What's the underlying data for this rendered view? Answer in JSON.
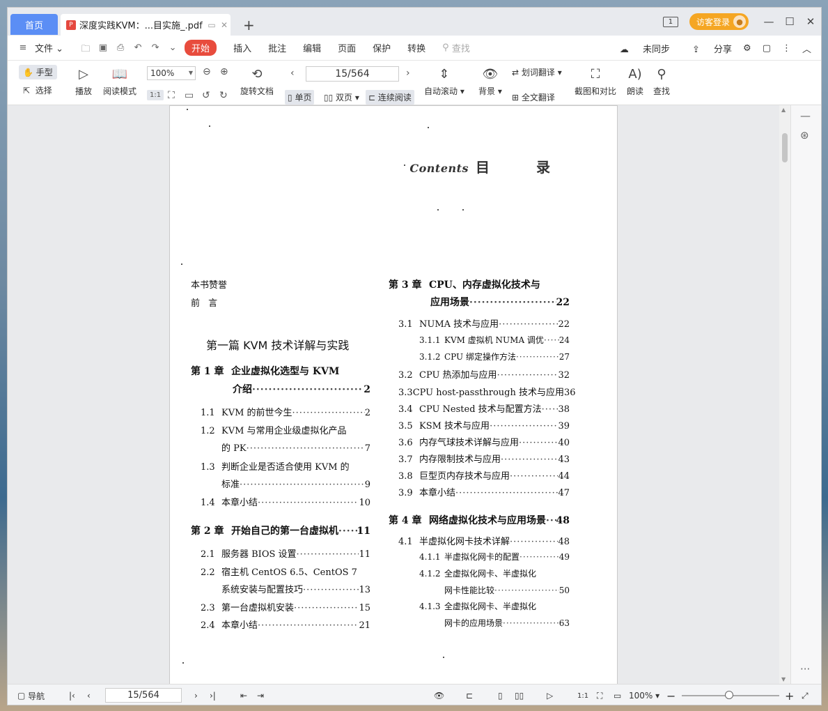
{
  "titlebar": {
    "home_tab": "首页",
    "doc_tab_title": "深度实践KVM：...目实施_.pdf",
    "new_tab": "+",
    "win_num": "1",
    "login": "访客登录"
  },
  "menu": {
    "file": "文件",
    "start": "开始",
    "items": [
      "插入",
      "批注",
      "编辑",
      "页面",
      "保护",
      "转换"
    ],
    "search": "查找",
    "sync": "未同步",
    "share": "分享"
  },
  "toolbar": {
    "hand": "手型",
    "select": "选择",
    "play": "播放",
    "read_mode": "阅读模式",
    "zoom": "100%",
    "rotate": "旋转文档",
    "page_input": "15/564",
    "single": "单页",
    "double": "双页",
    "continuous": "连续阅读",
    "auto_scroll": "自动滚动",
    "background": "背景",
    "word_translate": "划词翻译",
    "full_translate": "全文翻译",
    "screenshot": "截图和对比",
    "read_aloud": "朗读",
    "find": "查找"
  },
  "page": {
    "contents_word": "Contents",
    "title": "目 录",
    "left_col": [
      {
        "type": "plain",
        "text": "本书赞誉"
      },
      {
        "type": "plain",
        "text": "前 言"
      },
      {
        "type": "part",
        "text": "第一篇 KVM 技术详解与实践"
      },
      {
        "type": "chap",
        "num": "第 1 章",
        "text": "企业虚拟化选型与 KVM"
      },
      {
        "type": "chapcont",
        "text": "介绍",
        "page": "2"
      },
      {
        "type": "sec",
        "num": "1.1",
        "text": "KVM 的前世今生",
        "page": "2"
      },
      {
        "type": "sec",
        "num": "1.2",
        "text": "KVM 与常用企业级虚拟化产品"
      },
      {
        "type": "seccont",
        "text": "的 PK",
        "page": "7"
      },
      {
        "type": "sec",
        "num": "1.3",
        "text": "判断企业是否适合使用 KVM 的"
      },
      {
        "type": "seccont",
        "text": "标准",
        "page": "9"
      },
      {
        "type": "sec",
        "num": "1.4",
        "text": "本章小结",
        "page": "10"
      },
      {
        "type": "chap",
        "num": "第 2 章",
        "text": "开始自己的第一台虚拟机",
        "page": "11"
      },
      {
        "type": "sec",
        "num": "2.1",
        "text": "服务器 BIOS 设置",
        "page": "11"
      },
      {
        "type": "sec",
        "num": "2.2",
        "text": "宿主机 CentOS 6.5、CentOS 7"
      },
      {
        "type": "seccont",
        "text": "系统安装与配置技巧",
        "page": "13"
      },
      {
        "type": "sec",
        "num": "2.3",
        "text": "第一台虚拟机安装",
        "page": "15"
      },
      {
        "type": "sec",
        "num": "2.4",
        "text": "本章小结",
        "page": "21"
      }
    ],
    "right_col": [
      {
        "type": "chap",
        "num": "第 3 章",
        "text": "CPU、内存虚拟化技术与"
      },
      {
        "type": "chapcont",
        "text": "应用场景",
        "page": "22"
      },
      {
        "type": "sec",
        "num": "3.1",
        "text": "NUMA 技术与应用",
        "page": "22"
      },
      {
        "type": "subsec",
        "num": "3.1.1",
        "text": "KVM 虚拟机 NUMA 调优",
        "page": "24"
      },
      {
        "type": "subsec",
        "num": "3.1.2",
        "text": "CPU 绑定操作方法",
        "page": "27"
      },
      {
        "type": "sec",
        "num": "3.2",
        "text": "CPU 热添加与应用",
        "page": "32"
      },
      {
        "type": "sec",
        "num": "3.3",
        "text": "CPU host-passthrough 技术与应用",
        "page": "36"
      },
      {
        "type": "sec",
        "num": "3.4",
        "text": "CPU Nested 技术与配置方法",
        "page": "38"
      },
      {
        "type": "sec",
        "num": "3.5",
        "text": "KSM 技术与应用",
        "page": "39"
      },
      {
        "type": "sec",
        "num": "3.6",
        "text": "内存气球技术详解与应用",
        "page": "40"
      },
      {
        "type": "sec",
        "num": "3.7",
        "text": "内存限制技术与应用",
        "page": "43"
      },
      {
        "type": "sec",
        "num": "3.8",
        "text": "巨型页内存技术与应用",
        "page": "44"
      },
      {
        "type": "sec",
        "num": "3.9",
        "text": "本章小结",
        "page": "47"
      },
      {
        "type": "chap",
        "num": "第 4 章",
        "text": "网络虚拟化技术与应用场景",
        "page": "48"
      },
      {
        "type": "sec",
        "num": "4.1",
        "text": "半虚拟化网卡技术详解",
        "page": "48"
      },
      {
        "type": "subsec",
        "num": "4.1.1",
        "text": "半虚拟化网卡的配置",
        "page": "49"
      },
      {
        "type": "subsec",
        "num": "4.1.2",
        "text": "全虚拟化网卡、半虚拟化"
      },
      {
        "type": "subseccont",
        "text": "网卡性能比较",
        "page": "50"
      },
      {
        "type": "subsec",
        "num": "4.1.3",
        "text": "全虚拟化网卡、半虚拟化"
      },
      {
        "type": "subseccont",
        "text": "网卡的应用场景",
        "page": "63"
      }
    ]
  },
  "statusbar": {
    "nav": "导航",
    "page_input": "15/564",
    "zoom": "100%"
  }
}
